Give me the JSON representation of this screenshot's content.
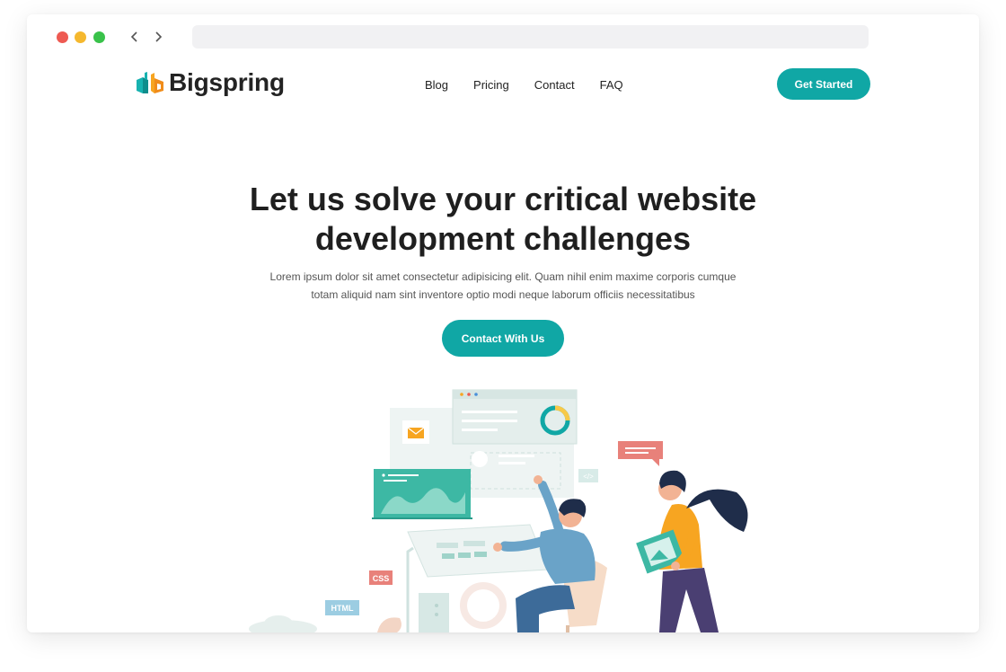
{
  "browser": {
    "url": ""
  },
  "brand": {
    "name": "Bigspring",
    "accent": "#10a7a5"
  },
  "nav": {
    "items": [
      "Blog",
      "Pricing",
      "Contact",
      "FAQ"
    ]
  },
  "header": {
    "cta_label": "Get Started"
  },
  "hero": {
    "title_line1": "Let us solve your critical website",
    "title_line2": "development challenges",
    "subtitle_line1": "Lorem ipsum dolor sit amet consectetur adipisicing elit. Quam nihil enim maxime corporis cumque",
    "subtitle_line2": "totam aliquid nam sint inventore optio modi neque laborum officiis necessitatibus",
    "cta_label": "Contact With Us"
  },
  "illustration": {
    "tag_css": "CSS",
    "tag_html": "HTML",
    "tag_code": "</>"
  }
}
